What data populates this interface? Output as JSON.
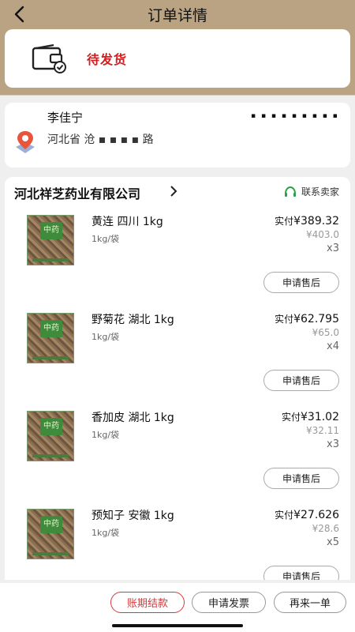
{
  "header": {
    "title": "订单详情",
    "back_icon": "back-arrow-icon"
  },
  "status": {
    "text": "待发货",
    "icon": "wallet-check-icon"
  },
  "address": {
    "name": "李佳宁",
    "phone": "▪ ▪ ▪ ▪ ▪ ▪ ▪ ▪ ▪",
    "text": "河北省 沧 ▪ ▪ ▪ ▪ 路",
    "icon": "location-pin-icon"
  },
  "shop": {
    "name": "河北祥芝药业有限公司",
    "contact_label": "联系卖家",
    "contact_icon": "headset-icon"
  },
  "items": [
    {
      "name": "黄连 四川 1kg",
      "unit": "1kg/袋",
      "real_label": "实付",
      "real_price": "¥389.32",
      "orig_price": "¥403.0",
      "qty": "x3",
      "aftersale": "申请售后",
      "thumb_label": "中药"
    },
    {
      "name": "野菊花 湖北 1kg",
      "unit": "1kg/袋",
      "real_label": "实付",
      "real_price": "¥62.795",
      "orig_price": "¥65.0",
      "qty": "x4",
      "aftersale": "申请售后",
      "thumb_label": "中药"
    },
    {
      "name": "香加皮 湖北 1kg",
      "unit": "1kg/袋",
      "real_label": "实付",
      "real_price": "¥31.02",
      "orig_price": "¥32.11",
      "qty": "x3",
      "aftersale": "申请售后",
      "thumb_label": "中药"
    },
    {
      "name": "预知子 安徽 1kg",
      "unit": "1kg/袋",
      "real_label": "实付",
      "real_price": "¥27.626",
      "orig_price": "¥28.6",
      "qty": "x5",
      "aftersale": "申请售后",
      "thumb_label": "中药"
    }
  ],
  "bottom": {
    "bill": "账期结款",
    "invoice": "申请发票",
    "again": "再来一单"
  },
  "colors": {
    "accent": "#d21e1e",
    "header_bg": "#b9a383",
    "contact_icon": "#2aa048"
  }
}
